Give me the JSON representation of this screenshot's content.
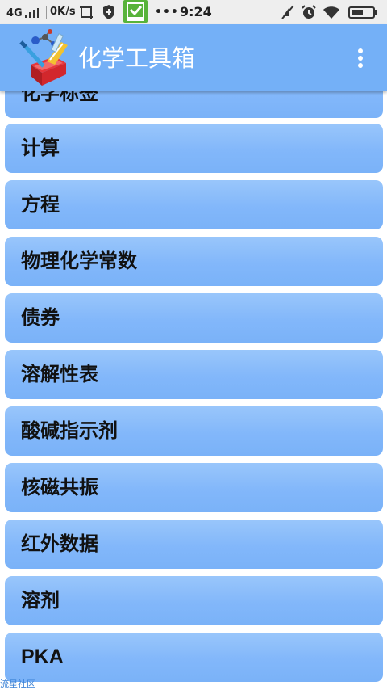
{
  "status_bar": {
    "network": "4G",
    "speed": "0K/s",
    "dots": "•••",
    "time": "9:24"
  },
  "app_bar": {
    "title": "化学工具箱"
  },
  "list": {
    "items": [
      {
        "label": "化学标签"
      },
      {
        "label": "计算"
      },
      {
        "label": "方程"
      },
      {
        "label": "物理化学常数"
      },
      {
        "label": "债券"
      },
      {
        "label": "溶解性表"
      },
      {
        "label": "酸碱指示剂"
      },
      {
        "label": "核磁共振"
      },
      {
        "label": "红外数据"
      },
      {
        "label": "溶剂"
      },
      {
        "label": "PKA"
      }
    ]
  },
  "watermark": "流星社区"
}
